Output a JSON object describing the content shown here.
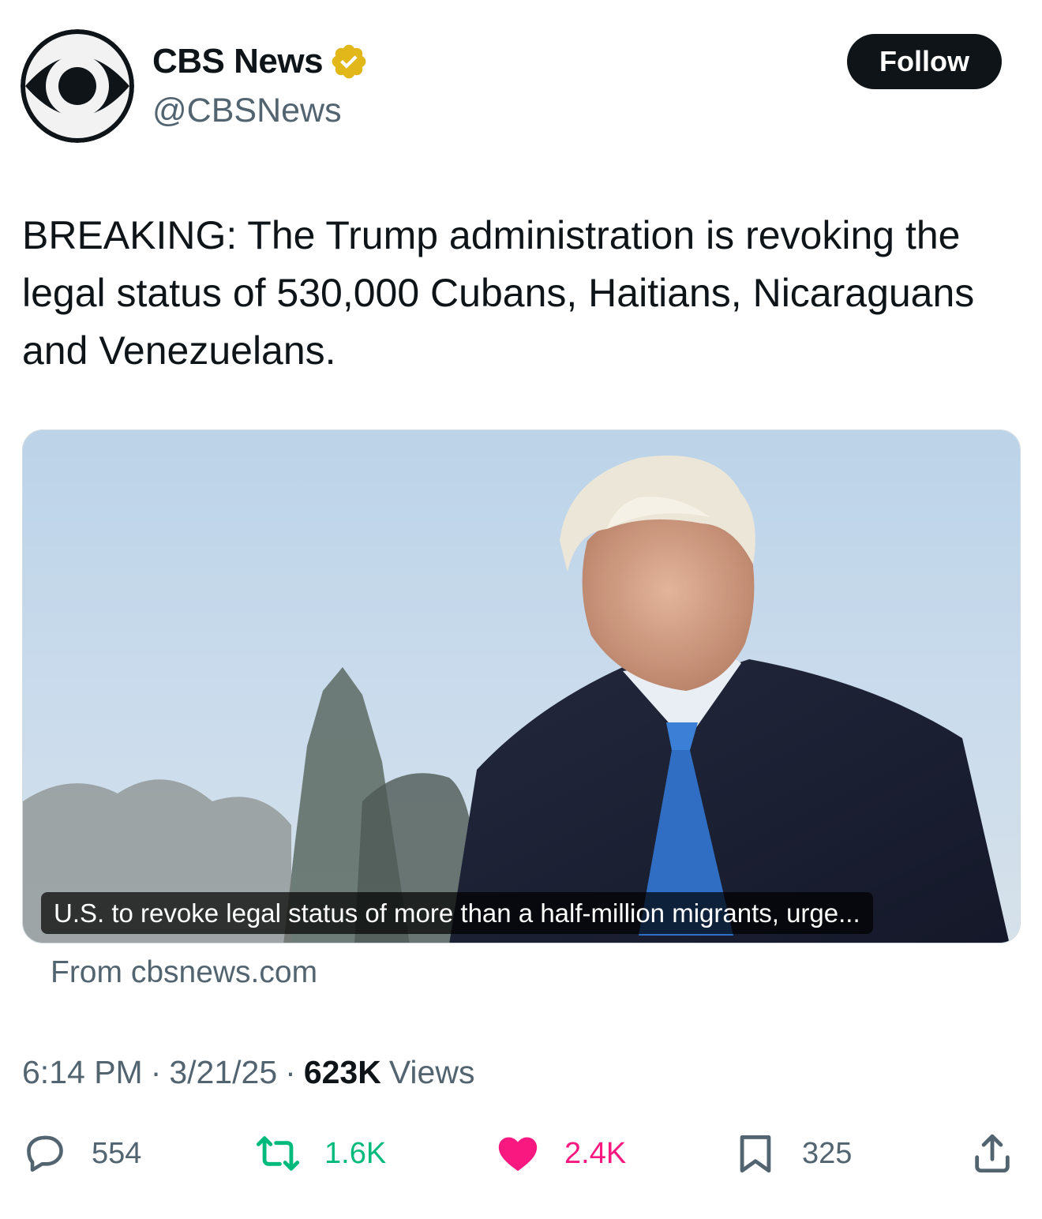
{
  "account": {
    "display_name": "CBS News",
    "handle": "@CBSNews",
    "verified": true,
    "avatar_icon": "cbs-eye-logo",
    "verified_icon": "verified-badge-gold-icon",
    "verified_color": "#e2b719"
  },
  "follow_button": {
    "label": "Follow"
  },
  "tweet": {
    "text": "BREAKING: The Trump administration is revoking the legal status of 530,000 Cubans, Haitians, Nicaraguans and Venezuelans."
  },
  "link_card": {
    "caption": "U.S. to revoke legal status of more than a half-million migrants, urge...",
    "source": "From cbsnews.com"
  },
  "meta": {
    "time": "6:14 PM",
    "separator": "·",
    "date": "3/21/25",
    "views_count": "623K",
    "views_label": "Views"
  },
  "actions": {
    "replies": {
      "icon": "reply-icon",
      "count": "554"
    },
    "reposts": {
      "icon": "retweet-icon",
      "count": "1.6K",
      "color": "#00ba7c"
    },
    "likes": {
      "icon": "heart-icon",
      "count": "2.4K",
      "color": "#f91880"
    },
    "bookmarks": {
      "icon": "bookmark-icon",
      "count": "325"
    },
    "share": {
      "icon": "share-icon"
    }
  },
  "colors": {
    "primary_text": "#0f1419",
    "secondary_text": "#536471",
    "follow_bg": "#0f1419"
  }
}
